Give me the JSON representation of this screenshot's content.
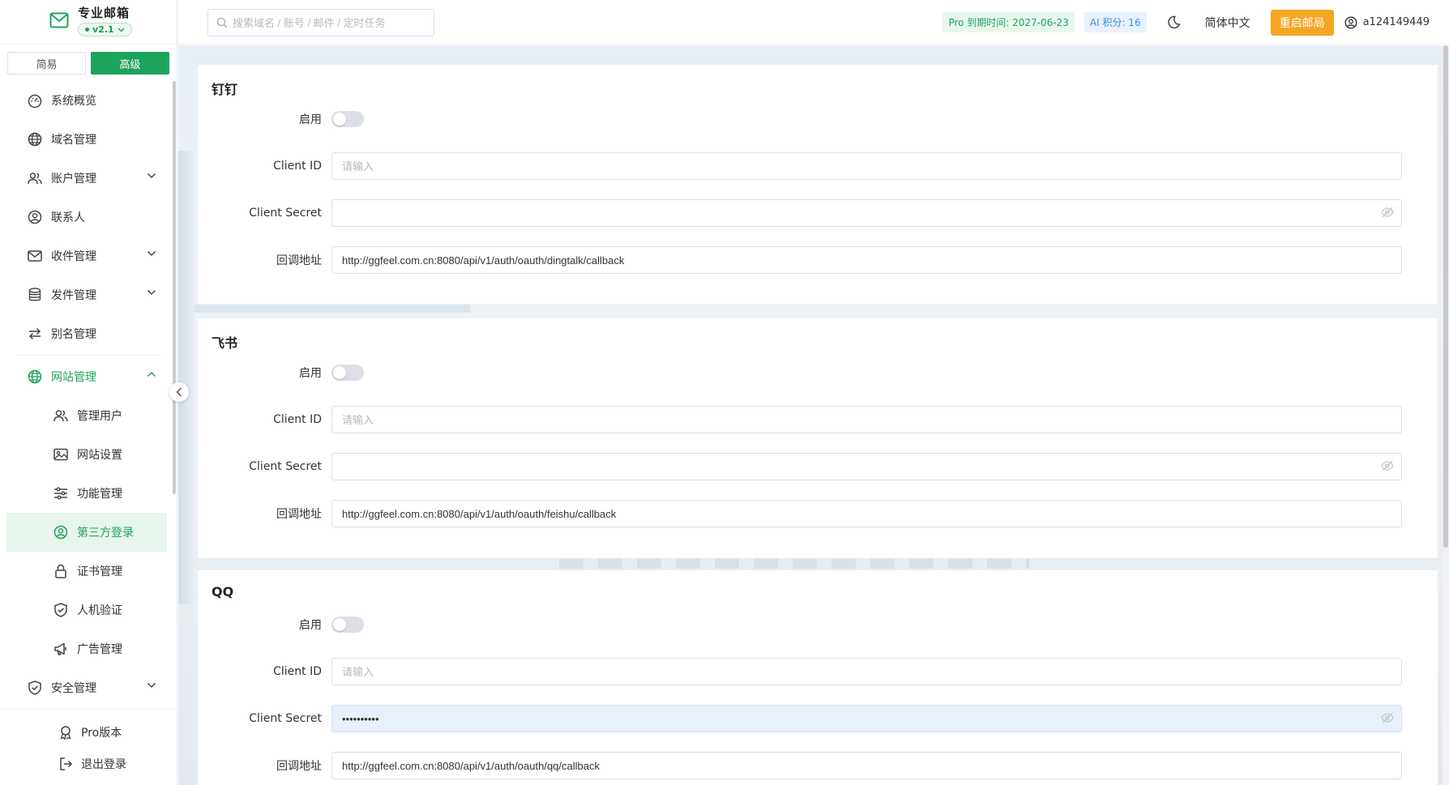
{
  "brand": {
    "title": "专业邮箱",
    "version": "v2.1"
  },
  "mode": {
    "simple": "简易",
    "advanced": "高级"
  },
  "menu": {
    "items": [
      {
        "label": "系统概览"
      },
      {
        "label": "域名管理"
      },
      {
        "label": "账户管理"
      },
      {
        "label": "联系人"
      },
      {
        "label": "收件管理"
      },
      {
        "label": "发件管理"
      },
      {
        "label": "别名管理"
      },
      {
        "label": "网站管理"
      },
      {
        "label": "管理用户"
      },
      {
        "label": "网站设置"
      },
      {
        "label": "功能管理"
      },
      {
        "label": "第三方登录"
      },
      {
        "label": "证书管理"
      },
      {
        "label": "人机验证"
      },
      {
        "label": "广告管理"
      },
      {
        "label": "安全管理"
      }
    ]
  },
  "footer": {
    "pro": "Pro版本",
    "logout": "退出登录"
  },
  "header": {
    "search_placeholder": "搜索域名 / 账号 / 邮件 / 定时任务",
    "pro_tag": "Pro 到期时间: 2027-06-23",
    "ai_tag": "AI 积分: 16",
    "language": "简体中文",
    "restart": "重启邮局",
    "username": "a124149449"
  },
  "form_labels": {
    "enable": "启用",
    "client_id": "Client ID",
    "client_secret": "Client Secret",
    "callback": "回调地址",
    "placeholder": "请输入"
  },
  "providers": [
    {
      "title": "钉钉",
      "client_secret": "",
      "callback": "http://ggfeel.com.cn:8080/api/v1/auth/oauth/dingtalk/callback"
    },
    {
      "title": "飞书",
      "client_secret": "",
      "callback": "http://ggfeel.com.cn:8080/api/v1/auth/oauth/feishu/callback"
    },
    {
      "title": "QQ",
      "client_secret": "••••••••••",
      "callback": "http://ggfeel.com.cn:8080/api/v1/auth/oauth/qq/callback"
    }
  ],
  "colors": {
    "accent": "#1ea35c",
    "restart": "#f5a623",
    "ai": "#3a8ee6"
  }
}
